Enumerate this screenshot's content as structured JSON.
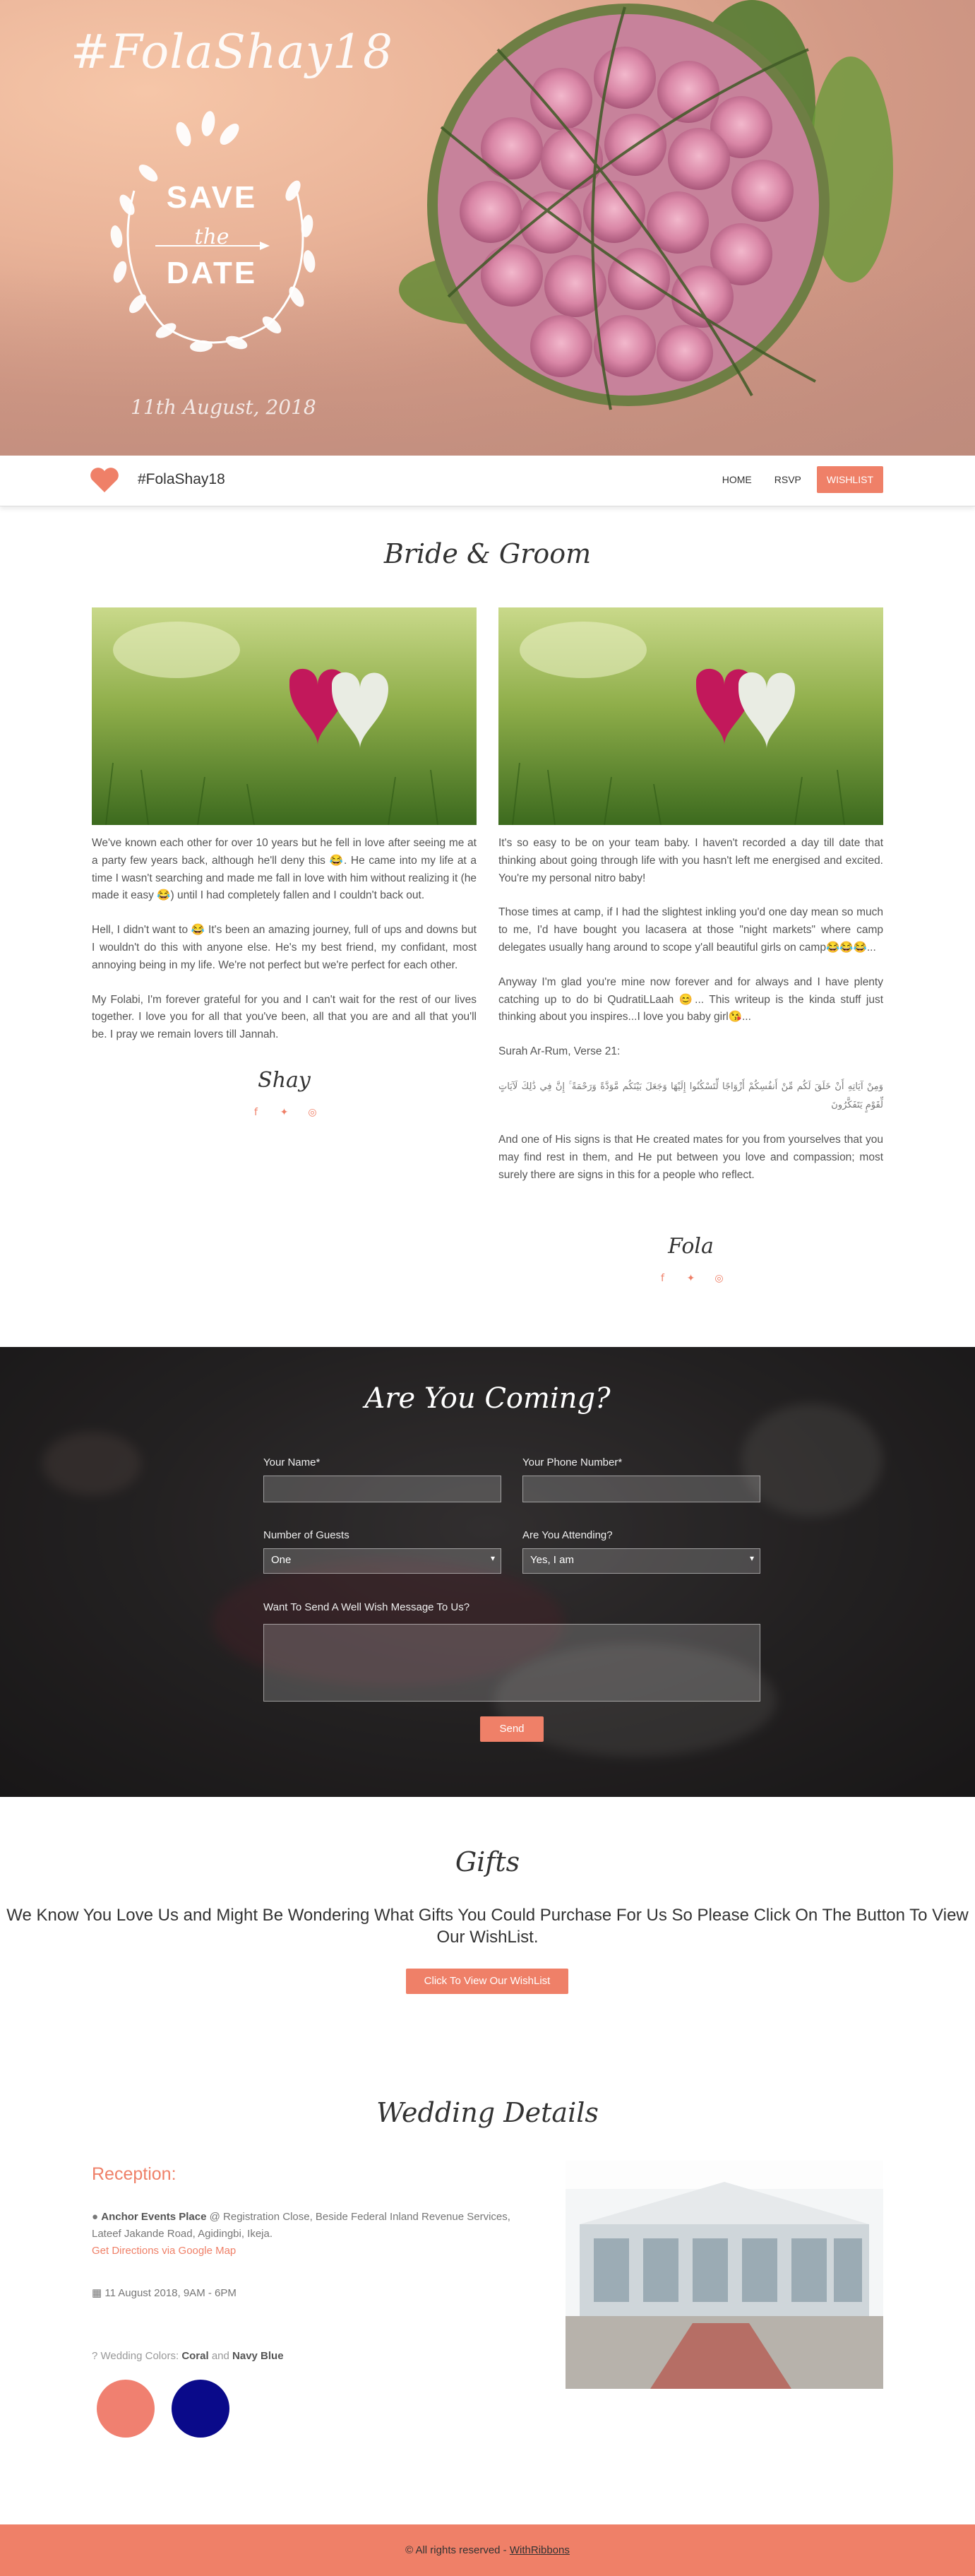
{
  "hero": {
    "hashtag": "#FolaShay18",
    "save": "SAVE",
    "the": "the",
    "date": "DATE",
    "wedding_date": "11th August, 2018"
  },
  "nav": {
    "brand": "#FolaShay18",
    "links": [
      "HOME",
      "RSVP",
      "WISHLIST"
    ]
  },
  "bride_groom": {
    "title": "Bride & Groom",
    "left": {
      "paragraphs": [
        "We've known each other for over 10 years but he fell in love after seeing me at a party few years back, although he'll deny this 😂. He came into my life at a time I wasn't searching and made me fall in love with him without realizing it (he made it easy 😂) until I had completely fallen and I couldn't back out.",
        "Hell, I didn't want to 😂 It's been an amazing journey, full of ups and downs but I wouldn't do this with anyone else. He's my best friend, my confidant, most annoying being in my life. We're not perfect but we're perfect for each other.",
        "My Folabi, I'm forever grateful for you and I can't wait for the rest of our lives together. I love you for all that you've been, all that you are and all that you'll be. I pray we remain lovers till Jannah."
      ],
      "signature": "Shay"
    },
    "right": {
      "paragraphs": [
        "It's so easy to be on your team baby. I haven't recorded a day till date that thinking about going through life with you hasn't left me energised and excited. You're my personal nitro baby!",
        "Those times at camp, if I had the slightest inkling you'd one day mean so much to me, I'd have bought you lacasera at those \"night markets\" where camp delegates usually hang around to scope y'all beautiful girls on camp😂😂😂...",
        "Anyway I'm glad you're mine now forever and for always and I have plenty catching up to do bi QudratiLLaah 😊... This writeup is the kinda stuff just thinking about you inspires...I love you baby girl😘...",
        "Surah Ar-Rum, Verse 21:"
      ],
      "arabic": "وَمِنْ آيَاتِهِ أَنْ خَلَقَ لَكُم مِّنْ أَنفُسِكُمْ أَزْوَاجًا لِّتَسْكُنُوا إِلَيْهَا وَجَعَلَ بَيْنَكُم مَّوَدَّةً وَرَحْمَةً ۚ إِنَّ فِي ذَٰلِكَ لَآيَاتٍ لِّقَوْمٍ يَتَفَكَّرُونَ",
      "translation": "And one of His signs is that He created mates for you from yourselves that you may find rest in them, and He put between you love and compassion; most surely there are signs in this for a people who reflect.",
      "signature": "Fola"
    },
    "social_icons": [
      "facebook-icon",
      "twitter-icon",
      "instagram-icon"
    ]
  },
  "rsvp": {
    "title": "Are You Coming?",
    "name_label": "Your Name*",
    "name_value": "",
    "phone_label": "Your Phone Number*",
    "phone_value": "",
    "guests_label": "Number of Guests",
    "guests_value": "One",
    "attending_label": "Are You Attending?",
    "attending_value": "Yes, I am",
    "message_label": "Want To Send A Well Wish Message To Us?",
    "message_value": "",
    "send": "Send"
  },
  "gifts": {
    "title": "Gifts",
    "text": "We Know You Love Us and Might Be Wondering What Gifts You Could Purchase For Us So Please Click On The Button To View Our WishList.",
    "button": "Click To View Our WishList"
  },
  "details": {
    "title": "Wedding Details",
    "reception": "Reception:",
    "venue_name": "Anchor Events Place",
    "venue_address": " @ Registration Close, Beside Federal Inland Revenue Services, Lateef Jakande Road, Agidingbi, Ikeja.",
    "directions": "Get Directions via Google Map",
    "datetime": "11 August 2018, 9AM - 6PM",
    "colors_prefix": "Wedding Colors:",
    "color1_name": "Coral",
    "colors_and": "and",
    "color2_name": "Navy Blue",
    "color1": "#f08070",
    "color2": "#0a0a8a"
  },
  "footer": {
    "text": "© All rights reserved -",
    "link": "WithRibbons"
  },
  "colors": {
    "accent": "#ef8068"
  }
}
